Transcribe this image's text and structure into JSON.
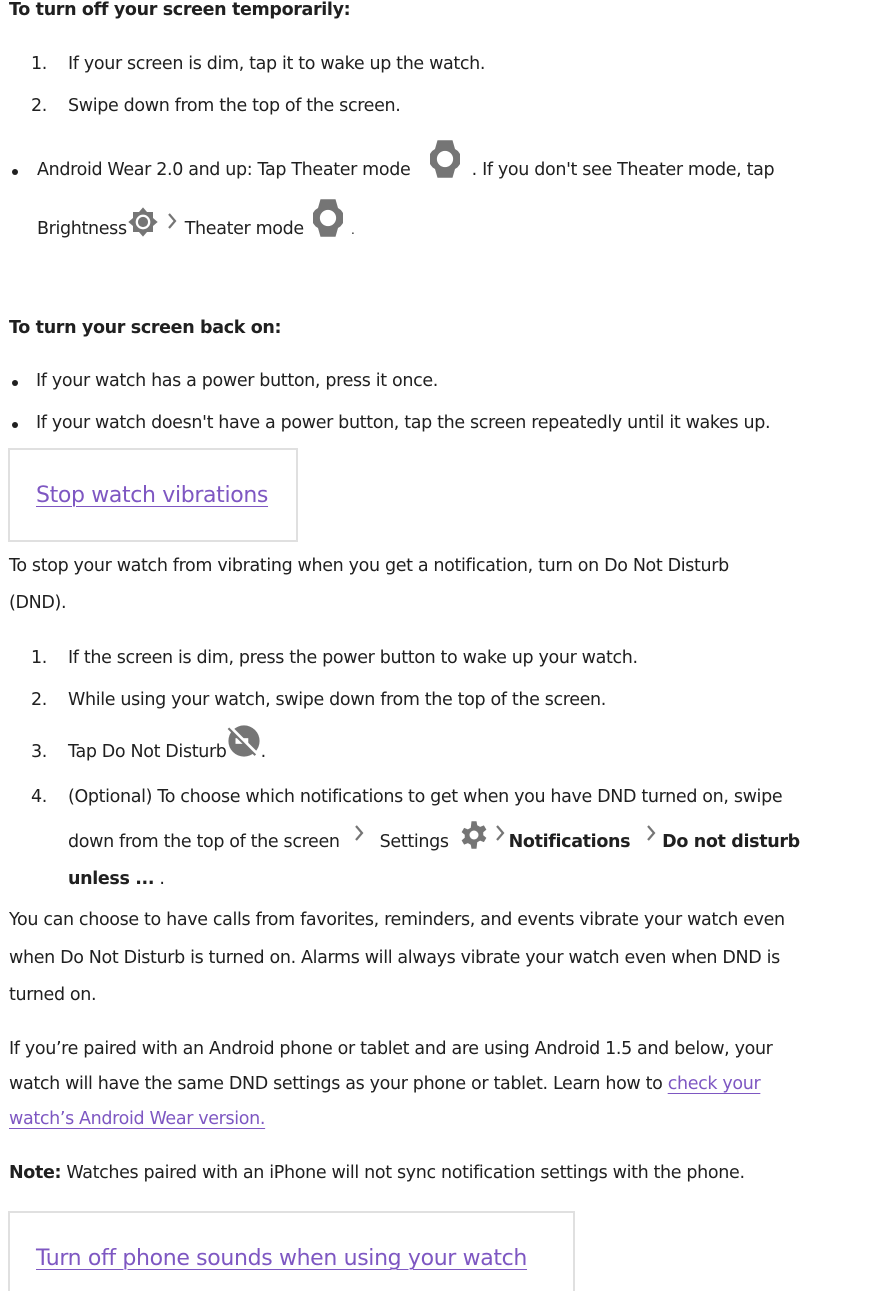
{
  "section1": {
    "heading": "To turn off your screen temporarily:",
    "steps": [
      {
        "num": "1.",
        "text": "If your screen is dim, tap it to wake up the watch."
      },
      {
        "num": "2.",
        "text": "Swipe down from the top of the screen."
      }
    ],
    "bullet": {
      "line1_a": "Android Wear 2.0 and up: Tap Theater mode",
      "line1_b": ". If you don't see Theater mode, tap",
      "line2_a": "Brightness",
      "line2_b": "Theater mode",
      "line2_c": "."
    }
  },
  "section2": {
    "heading": "To turn your screen back on:",
    "bullets": [
      "If your watch has a power button, press it once.",
      "If your watch doesn't have a power button, tap the screen repeatedly until it wakes up."
    ]
  },
  "card1": {
    "link": "Stop watch vibrations"
  },
  "section3": {
    "intro_line1": "To stop your watch from vibrating when you get a notification, turn on Do Not Disturb",
    "intro_line2": "(DND).",
    "steps": [
      {
        "num": "1.",
        "text": "If the screen is dim, press the power button to wake up your watch."
      },
      {
        "num": "2.",
        "text": "While using your watch, swipe down from the top of the screen."
      },
      {
        "num": "3.",
        "text": "Tap Do Not Disturb",
        "suffix": "."
      },
      {
        "num": "4.",
        "line1": "(Optional) To choose which notifications to get when you have DND turned on, swipe",
        "line2_a": "down from the top of the screen",
        "settings": "Settings",
        "notifications": "Notifications",
        "dnd": "Do not disturb",
        "line3_bold": "unless ...",
        "line3_suffix": " ."
      }
    ],
    "para1": [
      "You can choose to have calls from favorites, reminders, and events vibrate your watch even",
      "when Do Not Disturb is turned on. Alarms will always vibrate your watch even when DND is",
      "turned on."
    ],
    "para2_line1": "If you’re paired with an Android phone or tablet and are using Android 1.5 and below, your",
    "para2_line2": "watch will have the same DND settings as your phone or tablet. Learn how to ",
    "para2_link1": "check your",
    "para2_link2": "watch’s Android Wear version.",
    "note_label": "Note:",
    "note_text": " Watches paired with an iPhone will not sync notification settings with the phone."
  },
  "card2": {
    "link": "Turn off phone sounds when using your watch"
  },
  "colors": {
    "link": "#7e57c2",
    "icon": "#757575",
    "card_border": "#e0e0e0"
  },
  "icons": {
    "theater_mode": "watch-icon",
    "brightness": "brightness-icon",
    "chevron": "chevron-right-icon",
    "dnd": "do-not-disturb-icon",
    "settings": "gear-icon"
  }
}
